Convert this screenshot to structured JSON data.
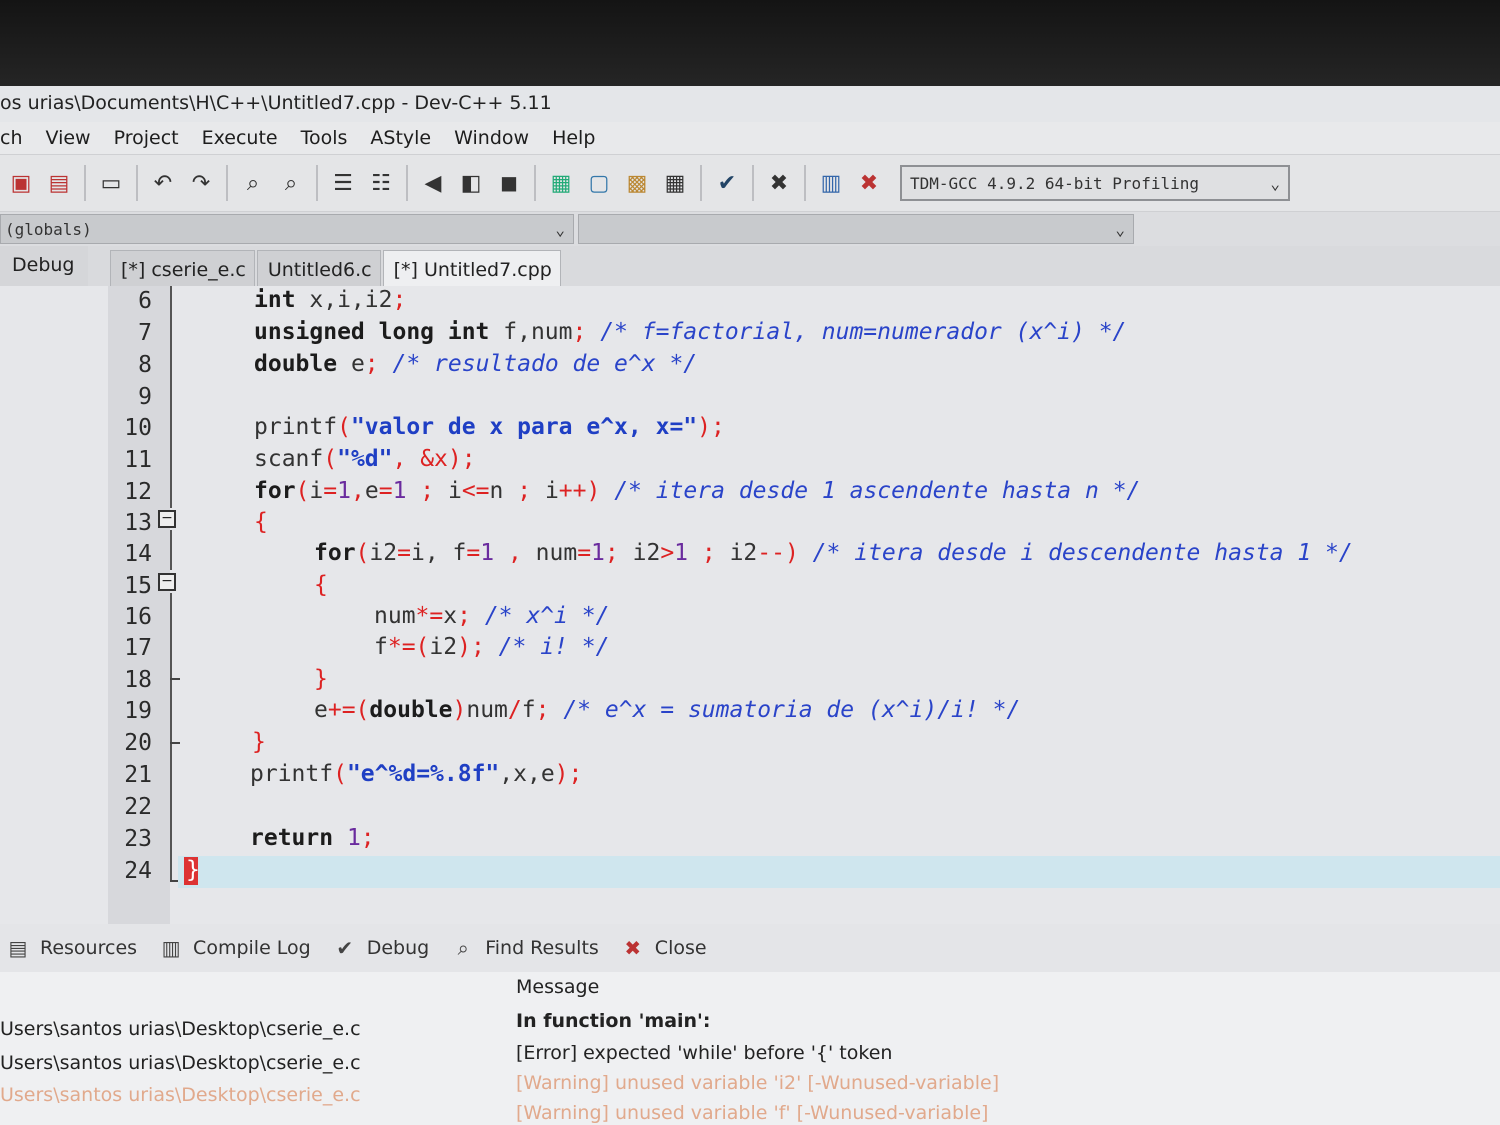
{
  "window": {
    "title": "os urias\\Documents\\H\\C++\\Untitled7.cpp - Dev-C++ 5.11"
  },
  "menu": [
    "ch",
    "View",
    "Project",
    "Execute",
    "Tools",
    "AStyle",
    "Window",
    "Help"
  ],
  "toolbar": {
    "compiler": "TDM-GCC 4.9.2 64-bit Profiling",
    "icons": [
      "save-all-icon",
      "close-file-icon",
      "print-icon",
      "undo-icon",
      "redo-icon",
      "find-icon",
      "replace-icon",
      "indent-icon",
      "unindent-icon",
      "back-icon",
      "forward-icon",
      "bookmark-icon",
      "new-class-icon",
      "project-icon",
      "grid-icon",
      "layout-icon",
      "check-icon",
      "stop-icon",
      "chart-icon",
      "delete-profile-icon"
    ]
  },
  "scope_combo": {
    "value": "(globals)"
  },
  "left_panel": {
    "tab": "Debug"
  },
  "file_tabs": [
    "[*] cserie_e.c",
    "Untitled6.c",
    "[*] Untitled7.cpp"
  ],
  "code_lines": [
    {
      "n": "6"
    },
    {
      "n": "7"
    },
    {
      "n": "8"
    },
    {
      "n": "9"
    },
    {
      "n": "10"
    },
    {
      "n": "11"
    },
    {
      "n": "12"
    },
    {
      "n": "13"
    },
    {
      "n": "14"
    },
    {
      "n": "15"
    },
    {
      "n": "16"
    },
    {
      "n": "17"
    },
    {
      "n": "18"
    },
    {
      "n": "19"
    },
    {
      "n": "20"
    },
    {
      "n": "21"
    },
    {
      "n": "22"
    },
    {
      "n": "23"
    },
    {
      "n": "24"
    }
  ],
  "code": {
    "l6": [
      "int",
      " x,i,i2",
      ";"
    ],
    "l7": [
      "unsigned long int",
      " f,num",
      ";",
      " /* f=factorial, num=numerador (x^i) */"
    ],
    "l8": [
      "double",
      " e",
      ";",
      " /* resultado de e^x */"
    ],
    "l10": [
      "printf",
      "(",
      "\"valor de x para e^x, x=\"",
      ");"
    ],
    "l11": [
      "scanf",
      "(",
      "\"%d\"",
      ", &x);"
    ],
    "l12": [
      "for",
      "(",
      "i",
      "=",
      "1",
      ",",
      "e",
      "=",
      "1",
      " ; ",
      "i",
      "<=",
      "n",
      " ; ",
      "i",
      "++)",
      " /* itera desde 1 ascendente hasta n */"
    ],
    "l13": [
      "{"
    ],
    "l14": [
      "for",
      "(",
      "i2",
      "=",
      "i, ",
      "f",
      "=",
      "1",
      " , ",
      "num",
      "=",
      "1",
      "; ",
      "i2",
      ">",
      "1",
      " ; ",
      "i2",
      "--)",
      " /* itera desde i descendente hasta 1 */"
    ],
    "l15": [
      "{"
    ],
    "l16": [
      "num",
      "*=",
      "x",
      ";",
      " /* x^i */"
    ],
    "l17": [
      "f",
      "*=(",
      "i2",
      ");",
      " /* i! */"
    ],
    "l18": [
      "}"
    ],
    "l19": [
      "e",
      "+=(",
      "double",
      ")",
      "num",
      "/",
      "f",
      ";",
      " /* e^x = sumatoria de (x^i)/i! */"
    ],
    "l20": [
      "}"
    ],
    "l21": [
      "printf",
      "(",
      "\"e^%d=%.8f\"",
      ",x,e",
      ");"
    ],
    "l23": [
      "return",
      " 1",
      ";"
    ],
    "l24": [
      "}"
    ]
  },
  "bottom_tabs": [
    "Resources",
    "Compile Log",
    "Debug",
    "Find Results",
    "Close"
  ],
  "messages": {
    "column_header": "Message",
    "files": [
      "Users\\santos urias\\Desktop\\cserie_e.c",
      "Users\\santos urias\\Desktop\\cserie_e.c",
      "Users\\santos urias\\Desktop\\cserie_e.c"
    ],
    "rows": [
      "In function 'main':",
      "[Error] expected 'while' before '{' token",
      "[Warning] unused variable 'i2' [-Wunused-variable]",
      "[Warning] unused variable 'f' [-Wunused-variable]"
    ]
  }
}
